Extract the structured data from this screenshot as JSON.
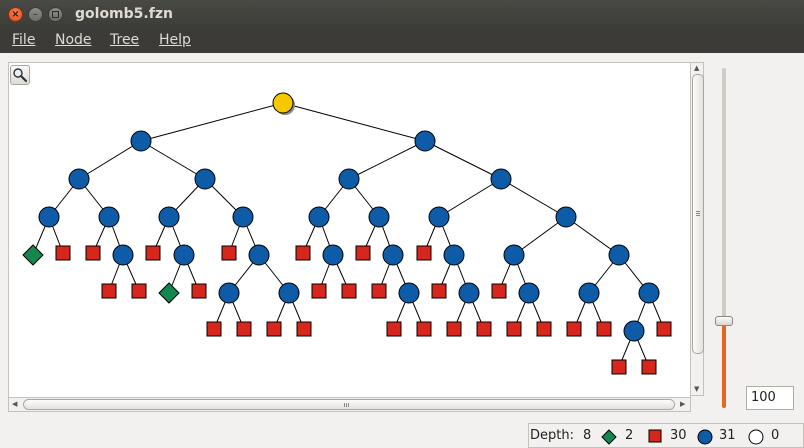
{
  "window": {
    "title": "golomb5.fzn"
  },
  "menu": {
    "items": [
      {
        "label": "File",
        "name": "menu-file"
      },
      {
        "label": "Node",
        "name": "menu-node"
      },
      {
        "label": "Tree",
        "name": "menu-tree"
      },
      {
        "label": "Help",
        "name": "menu-help"
      }
    ]
  },
  "colors": {
    "root": "#f7c800",
    "choice": "#0e5ca8",
    "failed": "#d7271c",
    "solved": "#13874e"
  },
  "icons": {
    "zoom": "magnifier-icon",
    "close": "close-icon",
    "minimize": "minimize-icon",
    "maximize": "maximize-icon"
  },
  "zoom": {
    "value": "100",
    "slider_level": 0.25
  },
  "status": {
    "depth_label": "Depth:",
    "depth": "8",
    "solved": "2",
    "failed": "30",
    "choice": "31",
    "open": "0"
  }
}
